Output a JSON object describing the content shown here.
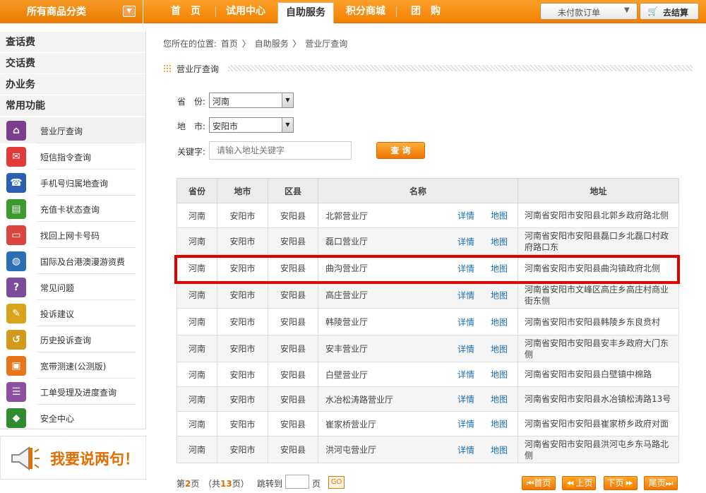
{
  "topbar": {
    "category_menu": "所有商品分类",
    "nav": [
      "首　页",
      "试用中心",
      "自助服务",
      "积分商城",
      "团　购"
    ],
    "active_nav": "自助服务",
    "unpaid_orders": "未付款订单",
    "checkout": "去结算"
  },
  "sidebar": {
    "sections": [
      "查话费",
      "交话费",
      "办业务",
      "常用功能"
    ],
    "items": [
      {
        "label": "营业厅查询",
        "icon": "house-icon",
        "color": "#7b3d8f"
      },
      {
        "label": "短信指令查询",
        "icon": "envelope-icon",
        "color": "#e23a3a"
      },
      {
        "label": "手机号归属地查询",
        "icon": "phone-search-icon",
        "color": "#2a5fb4"
      },
      {
        "label": "充值卡状态查询",
        "icon": "card-icon",
        "color": "#3c9a2e"
      },
      {
        "label": "找回上网卡号码",
        "icon": "card-search-icon",
        "color": "#d9453f"
      },
      {
        "label": "国际及台港澳漫游资费",
        "icon": "globe-icon",
        "color": "#2a6fb3"
      },
      {
        "label": "常见问题",
        "icon": "question-icon",
        "color": "#7b4b9e"
      },
      {
        "label": "投诉建议",
        "icon": "feedback-icon",
        "color": "#d9a41a"
      },
      {
        "label": "历史投诉查询",
        "icon": "history-icon",
        "color": "#d19a1a"
      },
      {
        "label": "宽带测速(公测版)",
        "icon": "speedtest-icon",
        "color": "#e8751a"
      },
      {
        "label": "工单受理及进度查询",
        "icon": "ticket-icon",
        "color": "#8c4fa2"
      },
      {
        "label": "安全中心",
        "icon": "shield-icon",
        "color": "#2e8b2e"
      }
    ],
    "feedback_banner": "我要说两句！"
  },
  "breadcrumb": {
    "prefix": "您所在的位置:",
    "items": [
      "首页",
      "自助服务",
      "营业厅查询"
    ],
    "separator": "〉"
  },
  "section_title": "营业厅查询",
  "form": {
    "province_label": "省　份:",
    "province_value": "河南",
    "city_label": "地　市:",
    "city_value": "安阳市",
    "keyword_label": "关键字:",
    "keyword_placeholder": "请输入地址关键字",
    "query_button": "查 询"
  },
  "table": {
    "headers": [
      "省份",
      "地市",
      "区县",
      "名称",
      "地址"
    ],
    "detail_label": "详情",
    "map_label": "地图",
    "rows": [
      {
        "province": "河南",
        "city": "安阳市",
        "county": "安阳县",
        "name": "北郭营业厅",
        "address": "河南省安阳市安阳县北郭乡政府路北侧"
      },
      {
        "province": "河南",
        "city": "安阳市",
        "county": "安阳县",
        "name": "磊口营业厅",
        "address": "河南省安阳市安阳县磊口乡北磊口村政府路口东"
      },
      {
        "province": "河南",
        "city": "安阳市",
        "county": "安阳县",
        "name": "曲沟营业厅",
        "address": "河南省安阳市安阳县曲沟镇政府北侧"
      },
      {
        "province": "河南",
        "city": "安阳市",
        "county": "安阳县",
        "name": "高庄营业厅",
        "address": "河南省安阳市文峰区高庄乡高庄村商业街东侧"
      },
      {
        "province": "河南",
        "city": "安阳市",
        "county": "安阳县",
        "name": "韩陵营业厅",
        "address": "河南省安阳市安阳县韩陵乡东良贲村"
      },
      {
        "province": "河南",
        "city": "安阳市",
        "county": "安阳县",
        "name": "安丰营业厅",
        "address": "河南省安阳市安阳县安丰乡政府大门东侧"
      },
      {
        "province": "河南",
        "city": "安阳市",
        "county": "安阳县",
        "name": "白壁营业厅",
        "address": "河南省安阳市安阳县白壁镇中棉路"
      },
      {
        "province": "河南",
        "city": "安阳市",
        "county": "安阳县",
        "name": "水冶松涛路营业厅",
        "address": "河南省安阳市安阳县水冶镇松涛路13号"
      },
      {
        "province": "河南",
        "city": "安阳市",
        "county": "安阳县",
        "name": "崔家桥营业厅",
        "address": "河南省安阳市安阳县崔家桥乡政府对面"
      },
      {
        "province": "河南",
        "city": "安阳市",
        "county": "安阳县",
        "name": "洪河屯营业厅",
        "address": "河南省安阳市安阳县洪河屯乡东马路北侧"
      }
    ]
  },
  "pager": {
    "page_prefix": "第",
    "current_page": "2",
    "page_suffix": "页",
    "total_prefix": "（共",
    "total_pages": "13",
    "total_suffix": "页）",
    "jump_label": "跳转到",
    "jump_suffix": "页",
    "go": "GO",
    "first": "首页",
    "prev": "上页",
    "next": "下页",
    "last": "尾页"
  }
}
